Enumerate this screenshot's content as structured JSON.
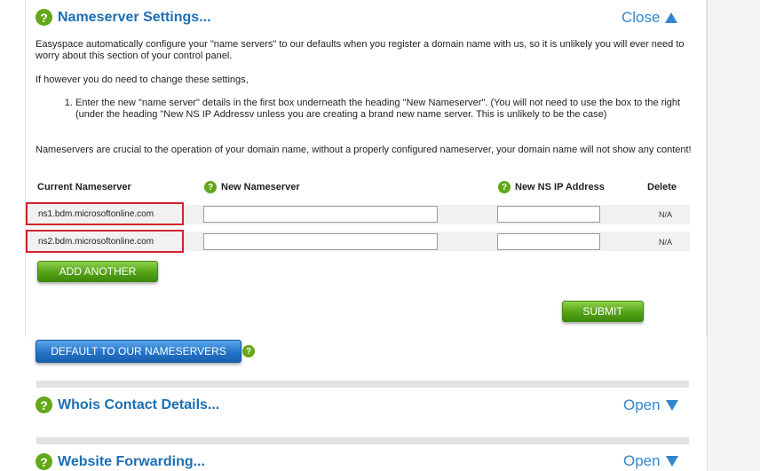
{
  "nameserver_section": {
    "title": "Nameserver Settings...",
    "toggle_label": "Close",
    "intro": "Easyspace automatically configure your \"name servers\" to our defaults when you register a domain name with us, so it is unlikely you will ever need to worry about this section of your control panel.",
    "however": "If however you do need to change these settings,",
    "step1": "Enter the new \"name server\" details in the first box underneath the heading \"New Nameserver\". (You will not need to use the box to the right (under the heading \"New NS IP Addressv unless you are creating a brand new name server. This is unlikely to be the case)",
    "crucial": "Nameservers are crucial to the operation of your domain name, without a properly configured nameserver, your domain name will not show any content!",
    "columns": {
      "current": "Current Nameserver",
      "new_ns": "New Nameserver",
      "new_ip": "New NS IP Address",
      "delete": "Delete"
    },
    "rows": [
      {
        "current": "ns1.bdm.microsoftonline.com",
        "new_ns": "",
        "new_ip": "",
        "delete": "N/A"
      },
      {
        "current": "ns2.bdm.microsoftonline.com",
        "new_ns": "",
        "new_ip": "",
        "delete": "N/A"
      }
    ],
    "add_another_label": "ADD ANOTHER",
    "submit_label": "SUBMIT",
    "default_label": "DEFAULT TO OUR NAMESERVERS"
  },
  "whois_section": {
    "title": "Whois Contact Details...",
    "toggle_label": "Open"
  },
  "forwarding_section": {
    "title": "Website Forwarding...",
    "toggle_label": "Open"
  },
  "colors": {
    "accent_blue": "#2f87cf",
    "title_blue": "#1c6fb3",
    "help_green": "#62a818",
    "highlight_red": "#d0232a"
  },
  "icons": {
    "help": "question-circle-icon",
    "close": "triangle-up-icon",
    "open": "triangle-down-icon"
  }
}
